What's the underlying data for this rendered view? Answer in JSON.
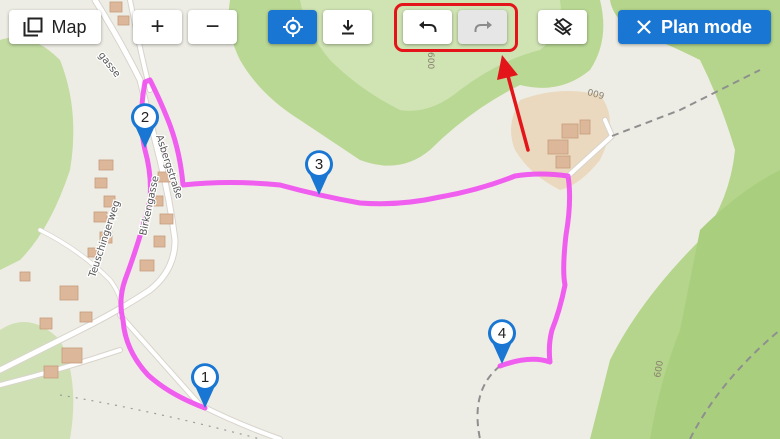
{
  "toolbar": {
    "map_button": {
      "label": "Map",
      "icon": "layers-square-icon"
    },
    "zoom_in": {
      "label": "+"
    },
    "zoom_out": {
      "label": "−"
    },
    "locate": {
      "icon": "crosshair-icon",
      "color": "#1976d2"
    },
    "download": {
      "icon": "download-icon"
    },
    "undo": {
      "icon": "undo-icon"
    },
    "redo": {
      "icon": "redo-icon",
      "state": "disabled"
    },
    "layers_off": {
      "icon": "layers-off-icon"
    },
    "plan_mode": {
      "label": "Plan mode",
      "icon": "close-icon",
      "color": "#1976d2"
    }
  },
  "annotation": {
    "color": "#e3151a",
    "target": "undo-redo-group"
  },
  "map": {
    "route_color": "#f04ef0",
    "streets": [
      "Asbergstraße",
      "Birkengasse",
      "Teuschingerweg",
      "gasse"
    ],
    "contour_labels": [
      "600",
      "600",
      "600"
    ],
    "waypoints": [
      {
        "label": "1"
      },
      {
        "label": "2"
      },
      {
        "label": "3"
      },
      {
        "label": "4"
      }
    ]
  }
}
